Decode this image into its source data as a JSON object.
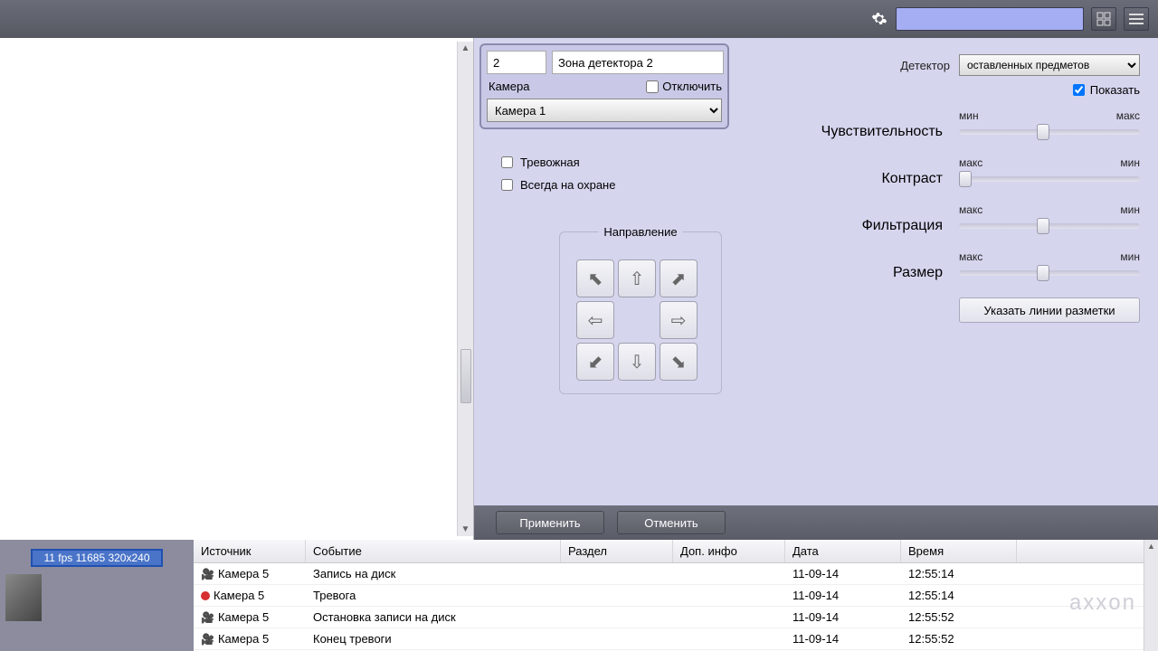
{
  "topbar": {
    "search_value": ""
  },
  "zone": {
    "id": "2",
    "name": "Зона детектора 2",
    "camera_label": "Камера",
    "disable_label": "Отключить",
    "camera_select": "Камера 1"
  },
  "checks": {
    "alarm": "Тревожная",
    "always_armed": "Всегда на охране"
  },
  "direction": {
    "title": "Направление"
  },
  "detector": {
    "label": "Детектор",
    "value": "оставленных предметов",
    "show": "Показать"
  },
  "sliders": {
    "min": "мин",
    "max": "макс",
    "sensitivity": "Чувствительность",
    "contrast": "Контраст",
    "filtering": "Фильтрация",
    "size": "Размер"
  },
  "markup_btn": "Указать линии разметки",
  "actions": {
    "apply": "Применить",
    "cancel": "Отменить"
  },
  "fps": "11 fps  11685 320x240",
  "table": {
    "headers": {
      "source": "Источник",
      "event": "Событие",
      "section": "Раздел",
      "add": "Доп. инфо",
      "date": "Дата",
      "time": "Время"
    },
    "rows": [
      {
        "icon": "cam",
        "source": "Камера 5",
        "event": "Запись на диск",
        "date": "11-09-14",
        "time": "12:55:14"
      },
      {
        "icon": "alarm",
        "source": "Камера 5",
        "event": "Тревога",
        "date": "11-09-14",
        "time": "12:55:14"
      },
      {
        "icon": "cam",
        "source": "Камера 5",
        "event": "Остановка записи на диск",
        "date": "11-09-14",
        "time": "12:55:52"
      },
      {
        "icon": "cam",
        "source": "Камера 5",
        "event": "Конец тревоги",
        "date": "11-09-14",
        "time": "12:55:52"
      }
    ]
  },
  "logo": "axxon"
}
